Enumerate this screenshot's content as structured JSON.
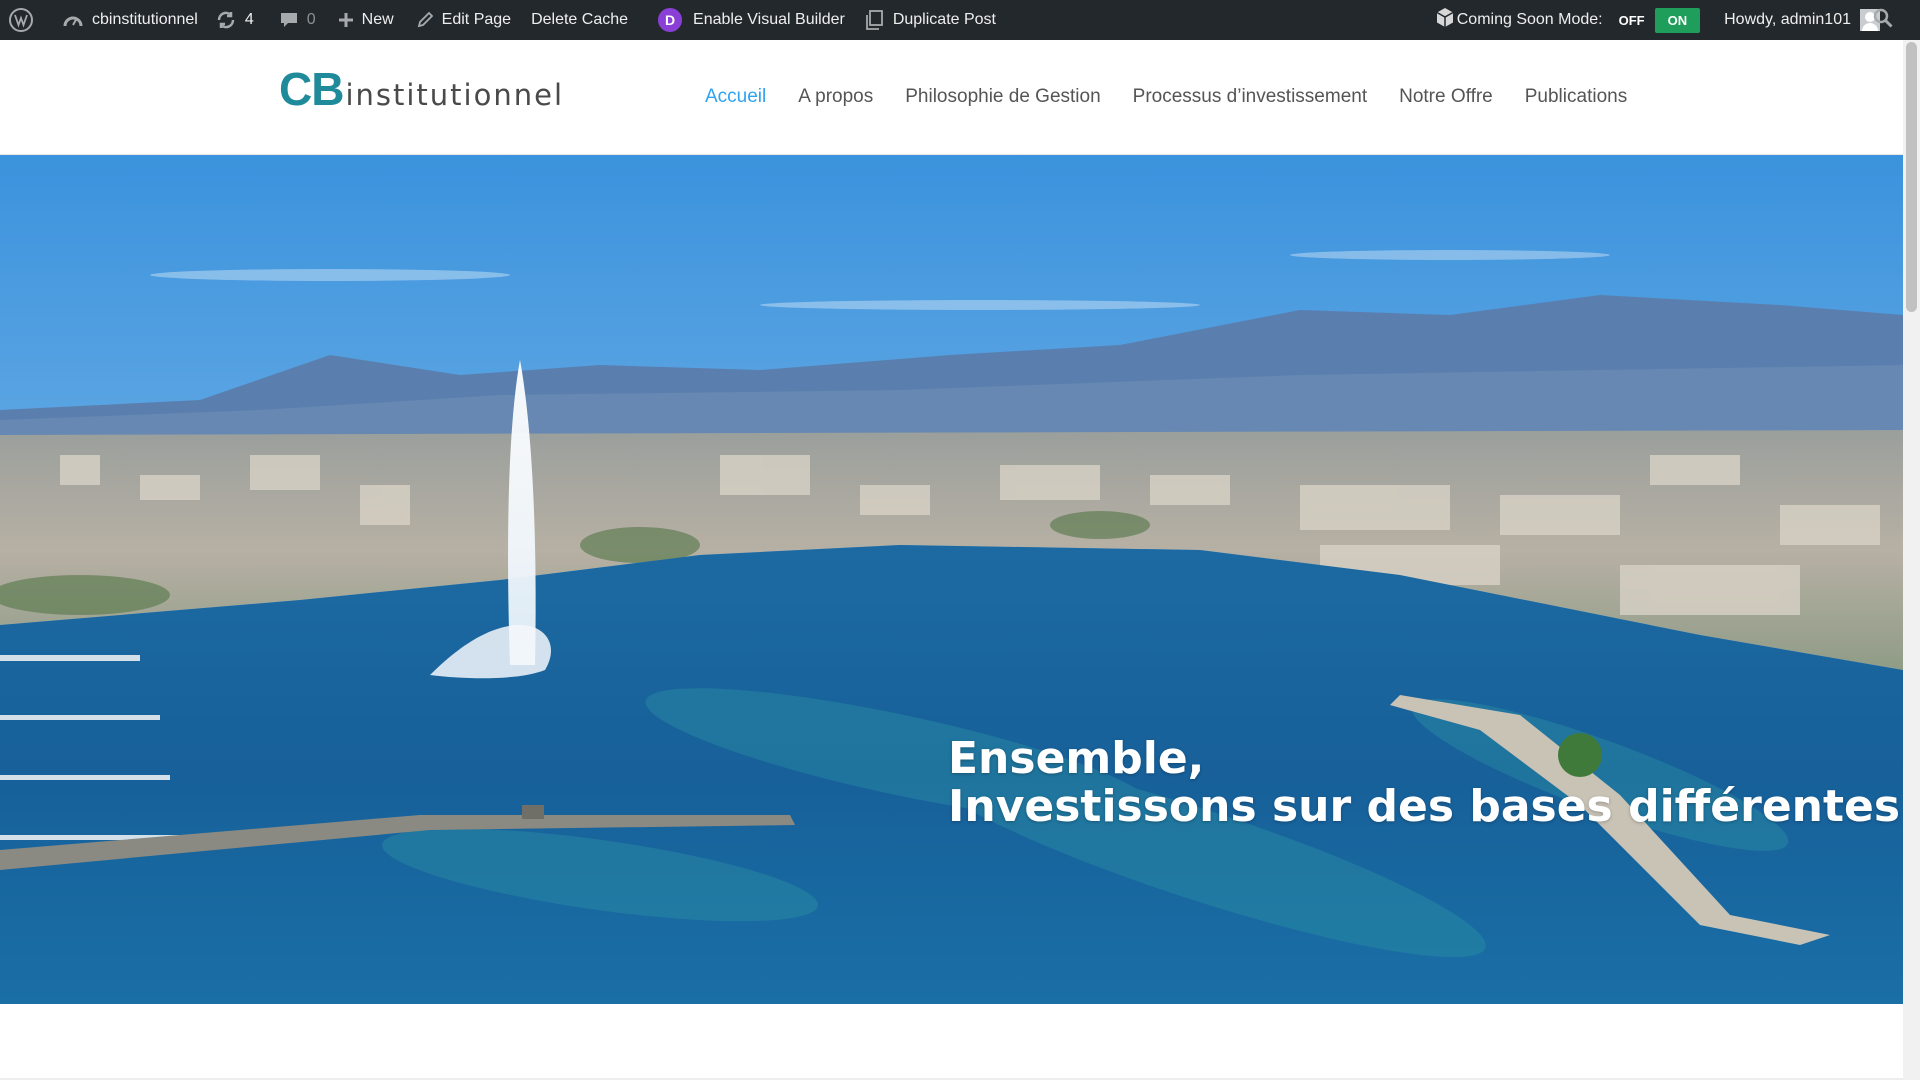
{
  "admin_bar": {
    "site_name": "cbinstitutionnel",
    "updates_count": "4",
    "comments_count": "0",
    "new_label": "New",
    "edit_page_label": "Edit Page",
    "delete_cache_label": "Delete Cache",
    "divi_badge": "D",
    "visual_builder_label": "Enable Visual Builder",
    "duplicate_label": "Duplicate Post",
    "coming_soon_label": "Coming Soon Mode:",
    "toggle_off": "OFF",
    "toggle_on": "ON",
    "greeting": "Howdy, admin101"
  },
  "header": {
    "logo_cb": "CB",
    "logo_rest": "institutionnel",
    "nav": [
      {
        "label": "Accueil",
        "active": true
      },
      {
        "label": "A propos"
      },
      {
        "label": "Philosophie de Gestion"
      },
      {
        "label": "Processus d’investissement"
      },
      {
        "label": "Notre Offre"
      },
      {
        "label": "Publications"
      }
    ]
  },
  "hero": {
    "line1": "Ensemble,",
    "line2": "Investissons sur des bases différentes"
  },
  "colors": {
    "accent": "#2ea3f2",
    "brand": "#1f8a9a",
    "admin_bar": "#23282d",
    "toggle_on": "#1e9e5a",
    "divi": "#8a40d6"
  },
  "icons": [
    "wordpress-icon",
    "dashboard-icon",
    "updates-icon",
    "comments-icon",
    "plus-icon",
    "pencil-icon",
    "duplicate-icon",
    "cube-icon",
    "search-icon"
  ]
}
